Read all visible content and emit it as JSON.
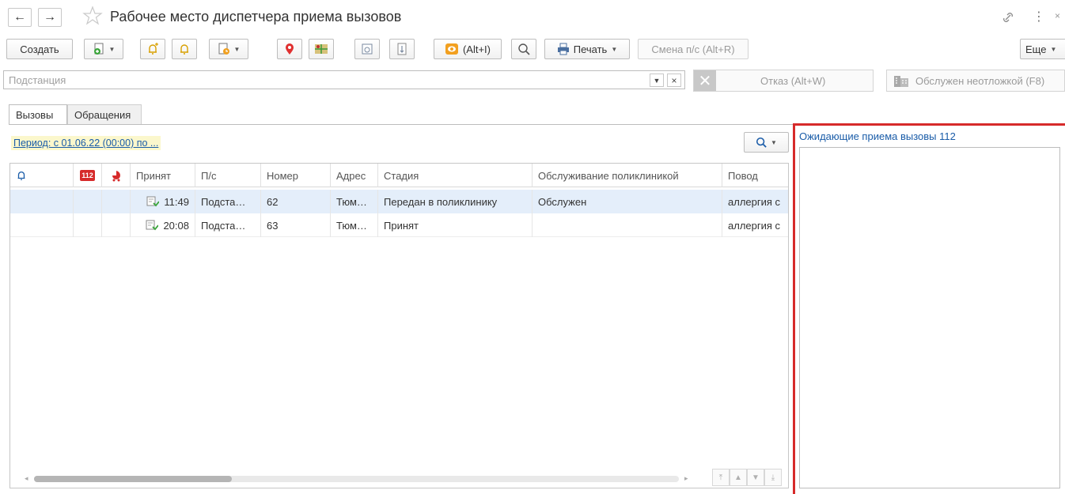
{
  "window": {
    "title": "Рабочее место диспетчера приема вызовов"
  },
  "toolbar": {
    "create_label": "Создать",
    "alt_i_label": "(Alt+I)",
    "print_label": "Печать",
    "change_ps_label": "Смена п/с (Alt+R)",
    "more_label": "Еще"
  },
  "filter": {
    "substation_placeholder": "Подстанция",
    "refuse_label": "Отказ (Alt+W)",
    "served_label": "Обслужен неотложкой (F8)"
  },
  "tabs": [
    {
      "label": "Вызовы",
      "active": true
    },
    {
      "label": "Обращения",
      "active": false
    }
  ],
  "period_text": "Период: с 01.06.22 (00:00)  по ...",
  "grid": {
    "badge_112": "112",
    "columns": {
      "accepted": "Принят",
      "ps": "П/с",
      "number": "Номер",
      "address": "Адрес",
      "stage": "Стадия",
      "clinic_service": "Обслуживание поликлиникой",
      "reason": "Повод"
    },
    "rows": [
      {
        "time": "11:49",
        "ps": "Подста…",
        "number": "62",
        "address": "Тюм…",
        "stage": "Передан в поликлинику",
        "clinic_service": "Обслужен",
        "reason": "аллергия с"
      },
      {
        "time": "20:08",
        "ps": "Подста…",
        "number": "63",
        "address": "Тюм…",
        "stage": "Принят",
        "clinic_service": "",
        "reason": "аллергия с"
      }
    ]
  },
  "right_panel": {
    "title": "Ожидающие приема вызовы 112"
  },
  "colors": {
    "accent_link": "#1a5ca8",
    "selected_row": "#e4eefa",
    "highlight_border": "#d62a2a",
    "period_bg": "#fbf7cc"
  }
}
